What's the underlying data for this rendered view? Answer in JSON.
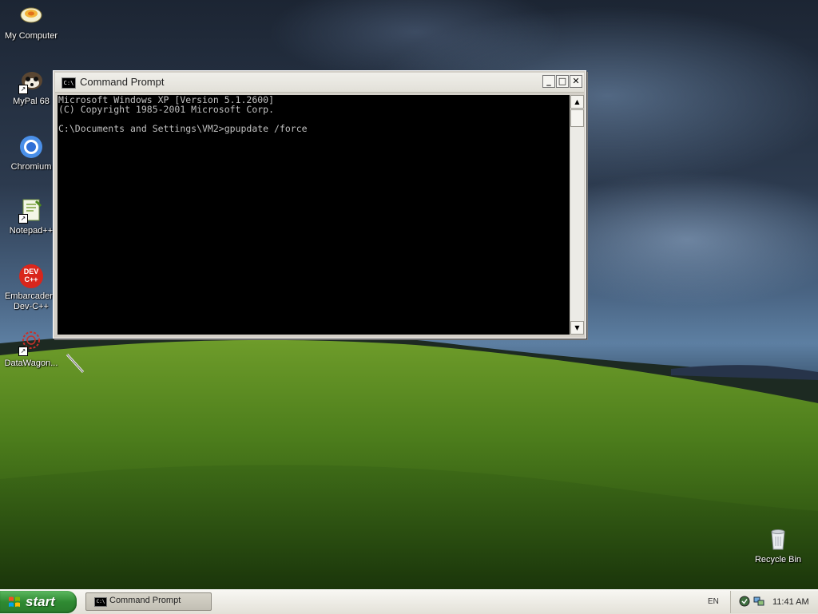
{
  "desktop": {
    "icons": [
      {
        "label": "My Computer",
        "icon": "my-computer-icon"
      },
      {
        "label": "MyPal 68",
        "icon": "mypal-icon"
      },
      {
        "label": "Chromium",
        "icon": "chromium-icon"
      },
      {
        "label": "Notepad++",
        "icon": "notepadpp-icon"
      },
      {
        "label": "Embarcadero\nDev-C++",
        "icon": "devcpp-icon"
      },
      {
        "label": "DataWagon...",
        "icon": "datawagon-icon"
      },
      {
        "label": "Recycle Bin",
        "icon": "recycle-bin-icon"
      }
    ],
    "devcpp_badge": "DEV\nC++"
  },
  "window": {
    "title": "Command Prompt",
    "icon_text": "C:\\",
    "buttons": {
      "minimize": "_",
      "maximize": "□",
      "close": "✕"
    },
    "console_lines": [
      "Microsoft Windows XP [Version 5.1.2600]",
      "(C) Copyright 1985-2001 Microsoft Corp.",
      "",
      "C:\\Documents and Settings\\VM2>gpupdate /force"
    ],
    "scroll_up": "▲",
    "scroll_down": "▼"
  },
  "taskbar": {
    "start_label": "start",
    "tasks": [
      {
        "label": "Command Prompt",
        "icon_text": "C:\\"
      }
    ],
    "language": "EN",
    "clock": "11:41 AM"
  },
  "colors": {
    "console_bg": "#000000",
    "console_text": "#c0c0c0",
    "start_green": "#2f8a32"
  }
}
